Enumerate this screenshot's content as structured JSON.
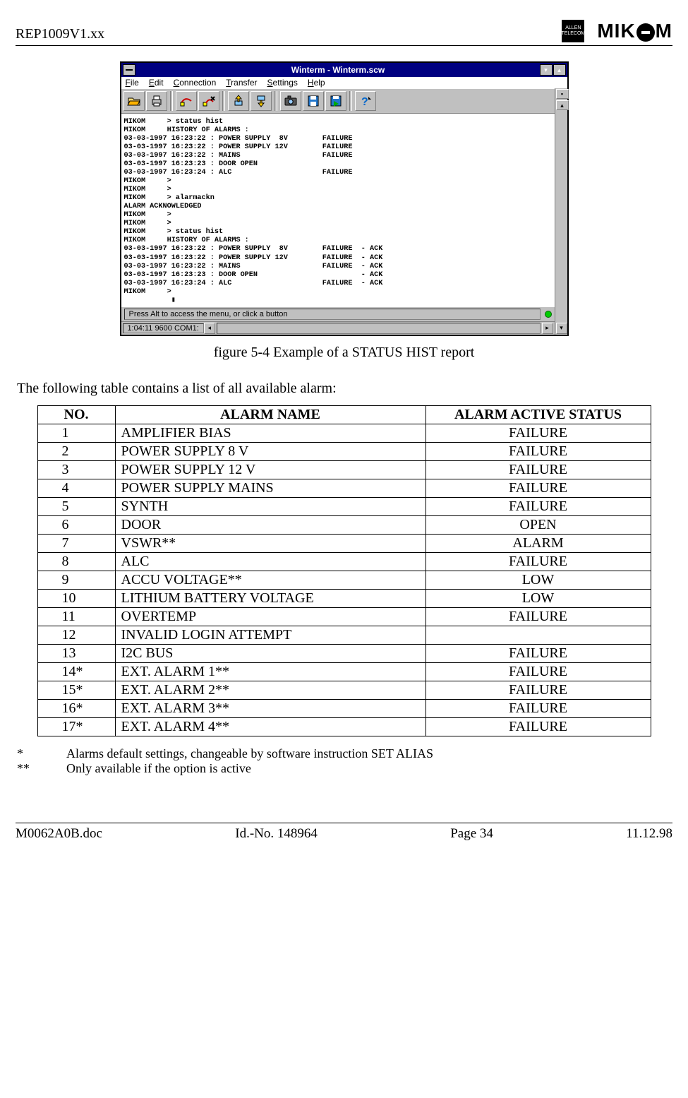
{
  "header": {
    "doc_ref": "REP1009V1.xx",
    "logo_allen_line1": "ALLEN",
    "logo_allen_line2": "TELECOM"
  },
  "window": {
    "title": "Winterm - Winterm.scw",
    "menu": [
      "File",
      "Edit",
      "Connection",
      "Transfer",
      "Settings",
      "Help"
    ],
    "terminal_lines": [
      "MIKOM     > status hist",
      "MIKOM     HISTORY OF ALARMS :",
      "03-03-1997 16:23:22 : POWER SUPPLY  8V        FAILURE",
      "03-03-1997 16:23:22 : POWER SUPPLY 12V        FAILURE",
      "03-03-1997 16:23:22 : MAINS                   FAILURE",
      "03-03-1997 16:23:23 : DOOR OPEN",
      "03-03-1997 16:23:24 : ALC                     FAILURE",
      "MIKOM     >",
      "MIKOM     >",
      "MIKOM     > alarmackn",
      "ALARM ACKNOWLEDGED",
      "MIKOM     >",
      "MIKOM     >",
      "MIKOM     > status hist",
      "MIKOM     HISTORY OF ALARMS :",
      "03-03-1997 16:23:22 : POWER SUPPLY  8V        FAILURE  - ACK",
      "03-03-1997 16:23:22 : POWER SUPPLY 12V        FAILURE  - ACK",
      "03-03-1997 16:23:22 : MAINS                   FAILURE  - ACK",
      "03-03-1997 16:23:23 : DOOR OPEN                        - ACK",
      "03-03-1997 16:23:24 : ALC                     FAILURE  - ACK",
      "MIKOM     >",
      "           ▮"
    ],
    "status_hint": "Press Alt to access the menu, or click a button",
    "bottom_status": "1:04:11  9600  COM1:"
  },
  "caption": "figure 5-4 Example of a STATUS HIST report",
  "intro": "The following table contains a list of all available alarm:",
  "table": {
    "headers": [
      "NO.",
      "ALARM NAME",
      "ALARM ACTIVE STATUS"
    ],
    "rows": [
      {
        "no": "1",
        "name": "AMPLIFIER BIAS",
        "status": "FAILURE"
      },
      {
        "no": "2",
        "name": "POWER SUPPLY 8 V",
        "status": "FAILURE"
      },
      {
        "no": "3",
        "name": "POWER SUPPLY 12 V",
        "status": "FAILURE"
      },
      {
        "no": "4",
        "name": "POWER SUPPLY MAINS",
        "status": "FAILURE"
      },
      {
        "no": "5",
        "name": "SYNTH",
        "status": "FAILURE"
      },
      {
        "no": "6",
        "name": "DOOR",
        "status": "OPEN"
      },
      {
        "no": "7",
        "name": "VSWR**",
        "status": "ALARM"
      },
      {
        "no": "8",
        "name": "ALC",
        "status": "FAILURE"
      },
      {
        "no": "9",
        "name": "ACCU VOLTAGE**",
        "status": "LOW"
      },
      {
        "no": "10",
        "name": "LITHIUM BATTERY VOLTAGE",
        "status": "LOW"
      },
      {
        "no": "11",
        "name": "OVERTEMP",
        "status": "FAILURE"
      },
      {
        "no": "12",
        "name": "INVALID LOGIN ATTEMPT",
        "status": ""
      },
      {
        "no": "13",
        "name": "I2C BUS",
        "status": "FAILURE"
      },
      {
        "no": "14*",
        "name": "EXT. ALARM 1**",
        "status": "FAILURE"
      },
      {
        "no": "15*",
        "name": "EXT. ALARM 2**",
        "status": "FAILURE"
      },
      {
        "no": "16*",
        "name": "EXT. ALARM 3**",
        "status": "FAILURE"
      },
      {
        "no": "17*",
        "name": "EXT. ALARM 4**",
        "status": "FAILURE"
      }
    ]
  },
  "footnotes": [
    {
      "mark": "*",
      "text": "Alarms default settings, changeable by software instruction SET ALIAS"
    },
    {
      "mark": "**",
      "text": "Only available if the option is active"
    }
  ],
  "footer": {
    "file": "M0062A0B.doc",
    "id": "Id.-No. 148964",
    "page": "Page 34",
    "date": "11.12.98"
  }
}
